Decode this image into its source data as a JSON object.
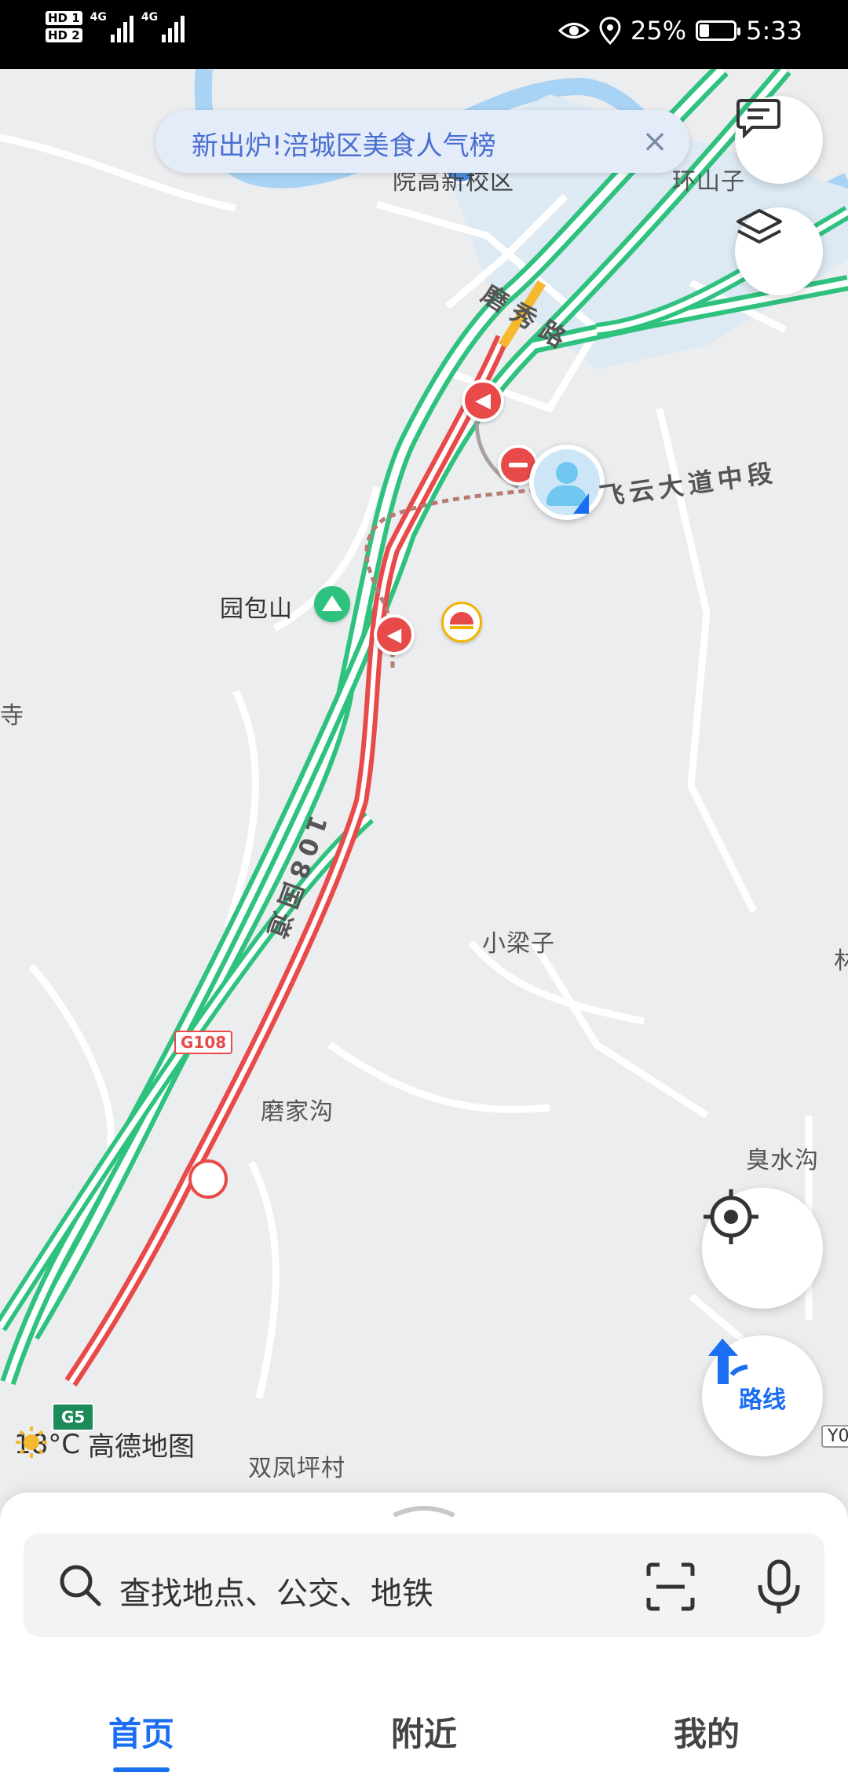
{
  "status_bar": {
    "hd1": "HD 1",
    "hd2": "HD 2",
    "net1": "4G",
    "net2": "4G",
    "battery": "25%",
    "battery_level": 0.25,
    "time": "5:33"
  },
  "banner": {
    "text": "新出炉!涪城区美食人气榜",
    "close": "×"
  },
  "map_labels": {
    "campus": "院高新校区",
    "huanshanzi": "环山子",
    "moxiu_road": "磨 秀 路",
    "feiyun": "飞云大道中段",
    "yuanbaoshan": "园包山",
    "si": "寺",
    "xiaoliangzi": "小梁子",
    "national_road": "108国道",
    "g108": "G108",
    "mojiagou": "磨家沟",
    "chou_shui_gou": "臭水沟",
    "shuangfeng": "双凤坪村",
    "right_edge": "林",
    "y0": "Y0"
  },
  "weather": {
    "temp": "18°C",
    "brand": "高德地图"
  },
  "g5": "G5",
  "route_button": {
    "label": "路线"
  },
  "search": {
    "placeholder": "查找地点、公交、地铁"
  },
  "tabs": [
    {
      "label": "首页",
      "active": true
    },
    {
      "label": "附近",
      "active": false
    },
    {
      "label": "我的",
      "active": false
    }
  ],
  "colors": {
    "accent": "#1a6ef2",
    "road_green": "#2ec27e",
    "road_red": "#e84a4a",
    "river": "#a8d3f5",
    "banner_text": "#4a6fd0"
  }
}
